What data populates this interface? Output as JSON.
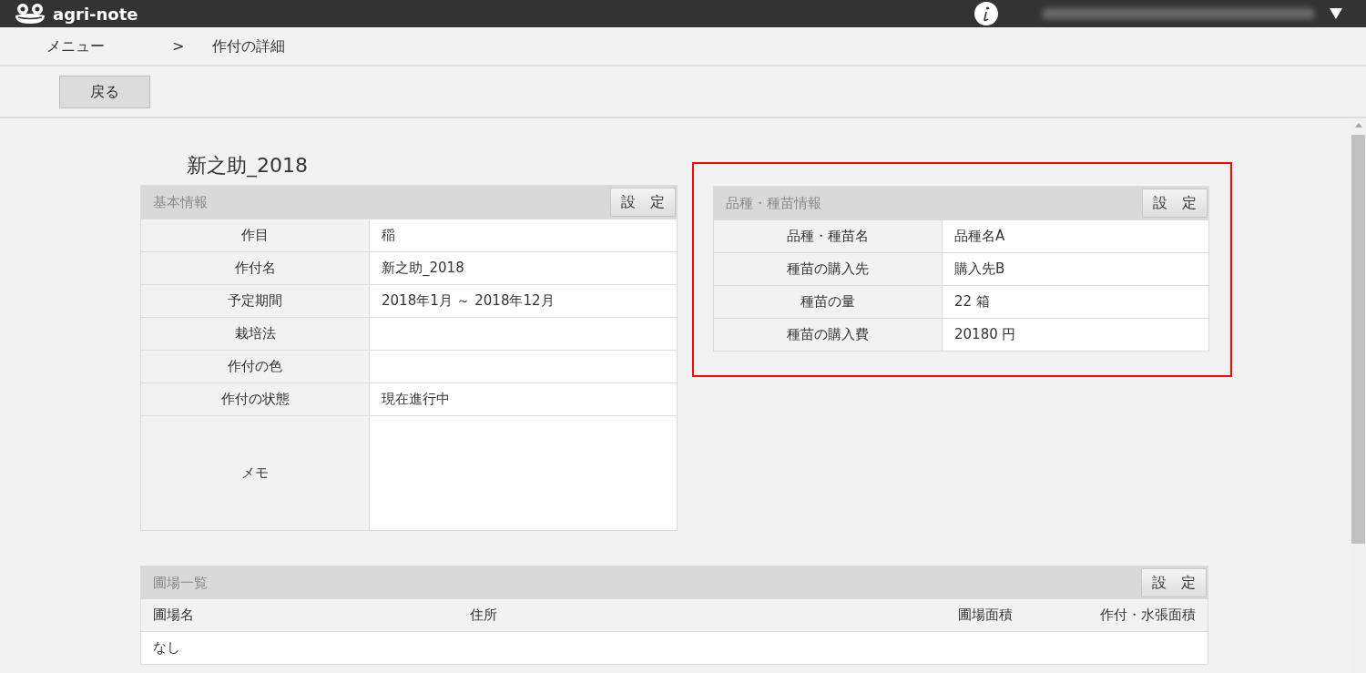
{
  "app": {
    "logo_text": "agri-note"
  },
  "breadcrumb": [
    {
      "label": "メニュー"
    },
    {
      "label": ">"
    },
    {
      "label": "作付の詳細"
    }
  ],
  "toolbar": {
    "back_button": "戻る"
  },
  "crop_title": "新之助_2018",
  "basic_info": {
    "title": "基本情報",
    "settings_button": "設　定",
    "rows": [
      {
        "label": "作目",
        "value": "稲"
      },
      {
        "label": "作付名",
        "value": "新之助_2018"
      },
      {
        "label": "予定期間",
        "value": "2018年1月 ～ 2018年12月"
      },
      {
        "label": "栽培法"
      },
      {
        "label": "作付の色"
      },
      {
        "label": "作付の状態",
        "value": "現在進行中"
      },
      {
        "kind": "memo",
        "label": "メモ"
      }
    ]
  },
  "variety_info": {
    "title": "品種・種苗情報",
    "settings_button": "設　定",
    "highlighted": true,
    "rows": [
      {
        "label": "品種・種苗名",
        "value": "品種名A"
      },
      {
        "label": "種苗の購入先",
        "value": "購入先B"
      },
      {
        "label": "種苗の量",
        "value": "22 箱"
      },
      {
        "label": "種苗の購入費",
        "value": "20180 円"
      }
    ]
  },
  "fields_list": {
    "title": "圃場一覧",
    "settings_button": "設　定",
    "columns": [
      "圃場名",
      "住所",
      "圃場面積",
      "作付・水張面積"
    ],
    "rows": [
      [
        "なし"
      ]
    ]
  }
}
